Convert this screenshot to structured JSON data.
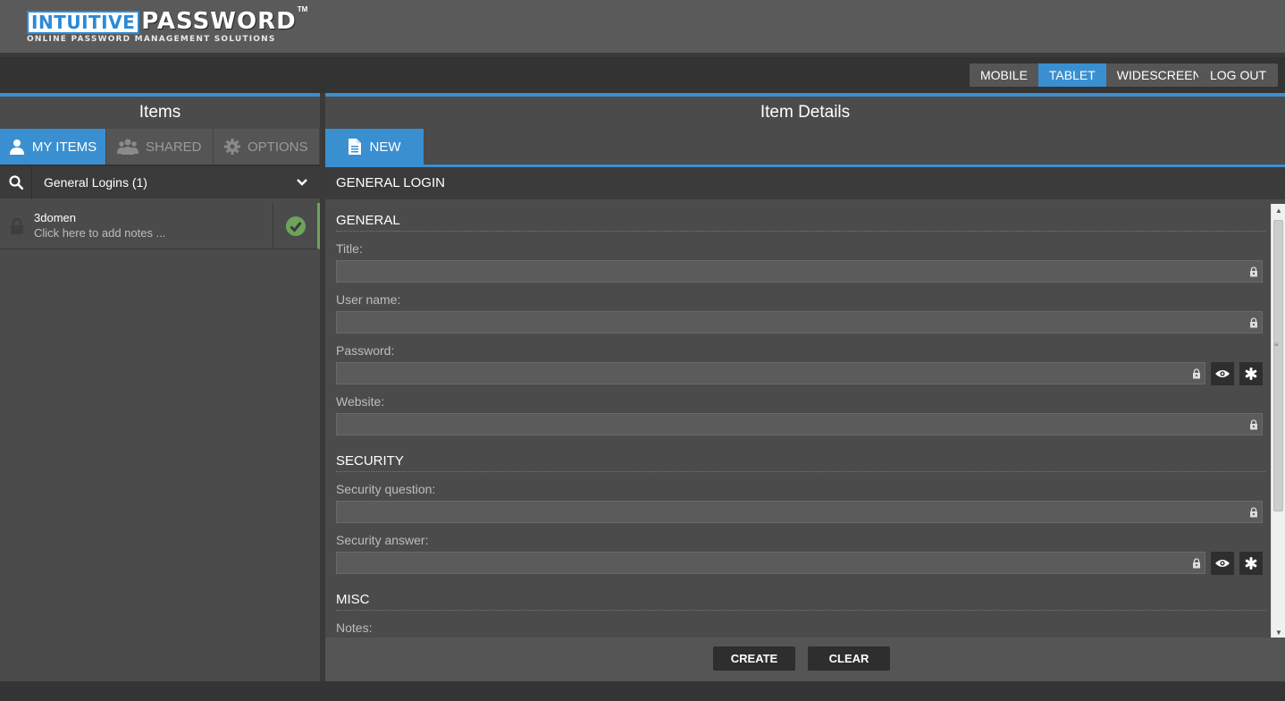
{
  "logo": {
    "boxed": "INTUITIVE",
    "word": "PASSWORD",
    "tm": "TM",
    "tagline": "ONLINE PASSWORD MANAGEMENT SOLUTIONS"
  },
  "topbar": {
    "views": [
      "MOBILE",
      "TABLET",
      "WIDESCREEN"
    ],
    "active_view": "TABLET",
    "logout": "LOG OUT"
  },
  "left": {
    "title": "Items",
    "tabs": [
      {
        "label": "MY ITEMS",
        "icon": "user-icon"
      },
      {
        "label": "SHARED",
        "icon": "group-icon"
      },
      {
        "label": "OPTIONS",
        "icon": "gear-icon"
      }
    ],
    "filter": "General Logins (1)",
    "items": [
      {
        "name": "3domen",
        "note": "Click here to add notes ..."
      }
    ]
  },
  "right": {
    "title": "Item Details",
    "new_tab": "NEW",
    "section": "GENERAL LOGIN",
    "groups": {
      "general": "GENERAL",
      "security": "SECURITY",
      "misc": "MISC"
    },
    "fields": {
      "title": "Title:",
      "username": "User name:",
      "password": "Password:",
      "website": "Website:",
      "sec_question": "Security question:",
      "sec_answer": "Security answer:",
      "notes": "Notes:"
    },
    "buttons": {
      "create": "CREATE",
      "clear": "CLEAR"
    }
  },
  "colors": {
    "accent": "#3a8fd0",
    "success": "#6ea35b"
  }
}
